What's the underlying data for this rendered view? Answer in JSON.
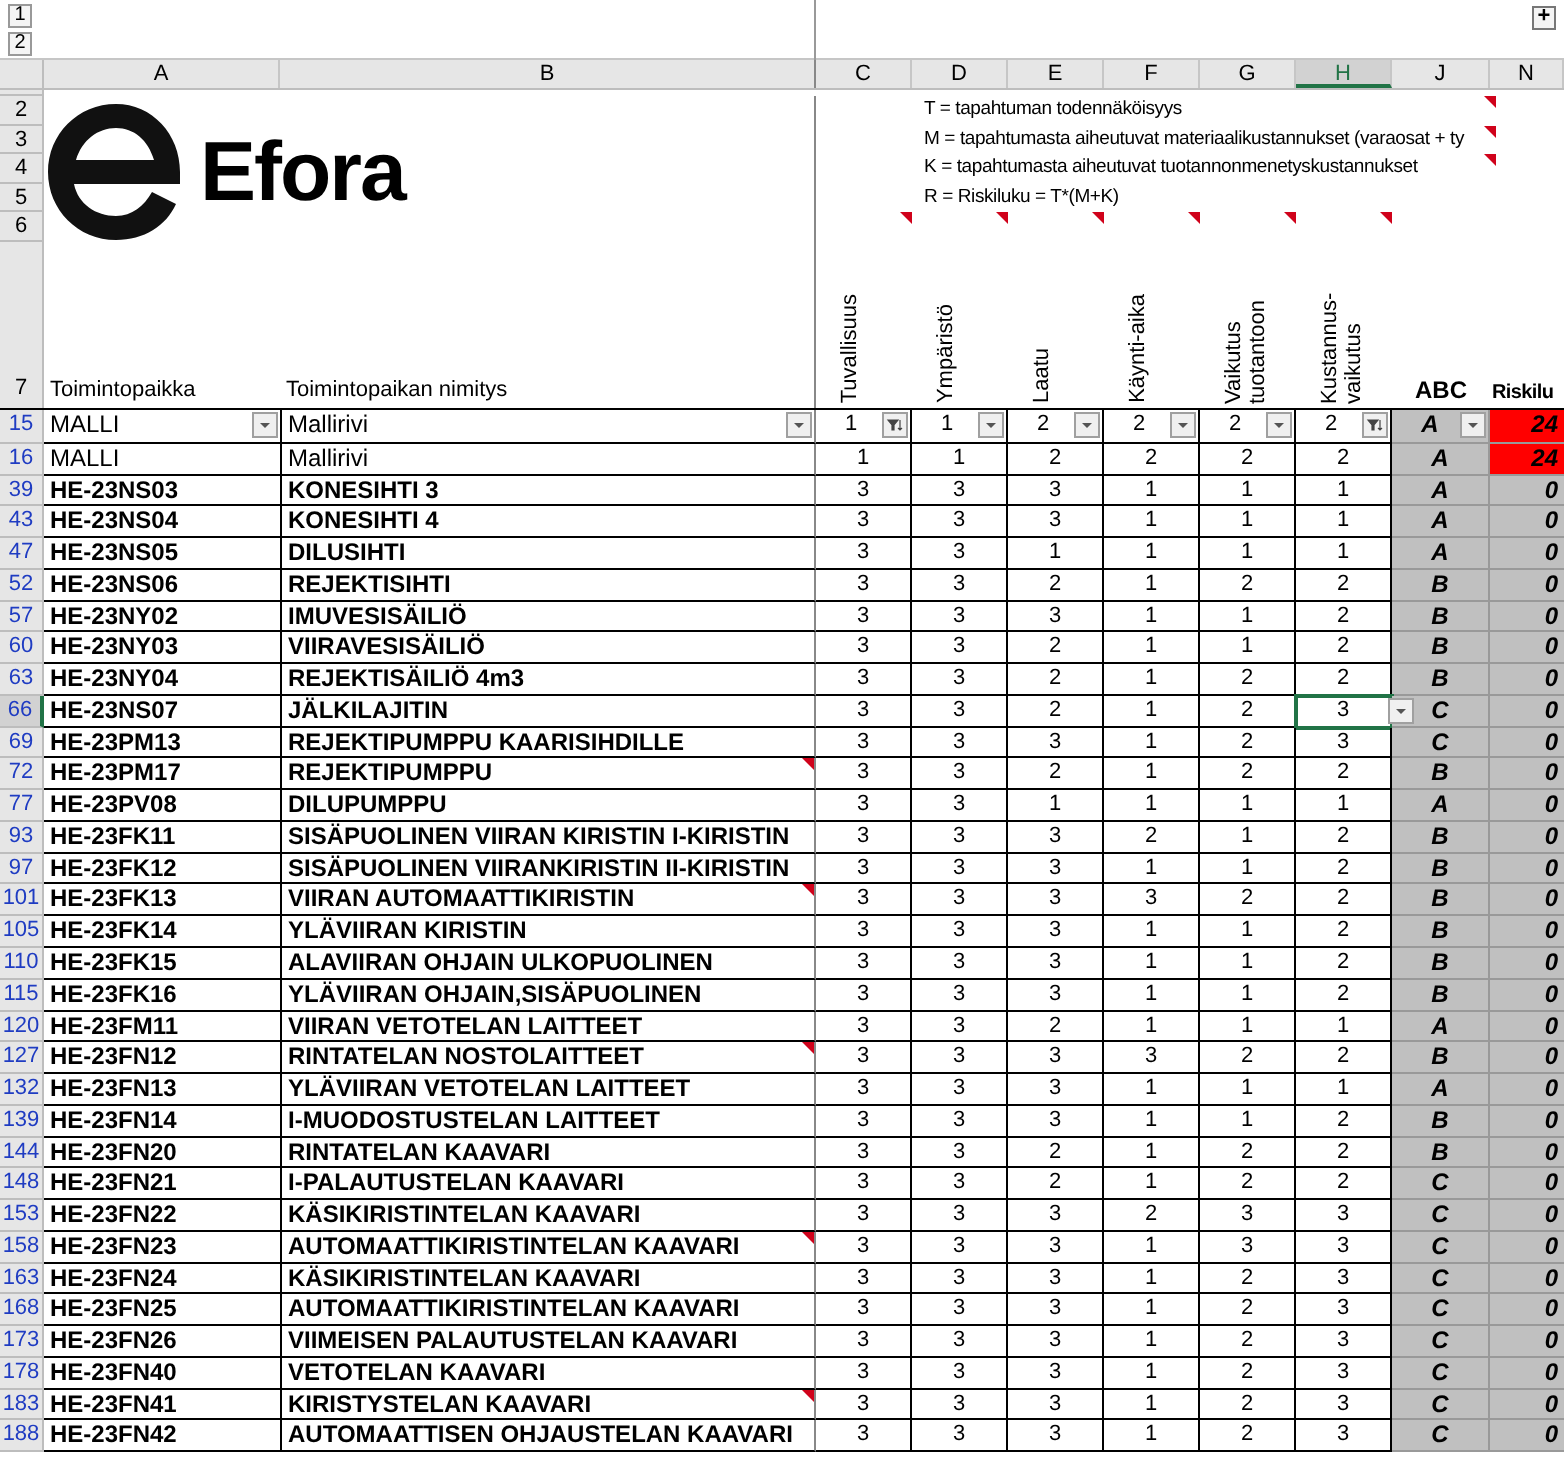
{
  "outline": {
    "levels": [
      "1",
      "2"
    ],
    "expand_symbol": "+"
  },
  "column_headers": [
    {
      "label": "A",
      "selected": false
    },
    {
      "label": "B",
      "selected": false
    },
    {
      "label": "C",
      "selected": false
    },
    {
      "label": "D",
      "selected": false
    },
    {
      "label": "E",
      "selected": false
    },
    {
      "label": "F",
      "selected": false
    },
    {
      "label": "G",
      "selected": false
    },
    {
      "label": "H",
      "selected": true
    },
    {
      "label": "J",
      "selected": false
    },
    {
      "label": "N",
      "selected": false
    }
  ],
  "header_row_numbers": [
    "2",
    "3",
    "4",
    "5",
    "6",
    "7"
  ],
  "logo": {
    "text": "Efora"
  },
  "legend": [
    {
      "text": "T =   tapahtuman todennäköisyys",
      "comment": true
    },
    {
      "text": "M =   tapahtumasta aiheutuvat materiaalikustannukset (varaosat + ty",
      "comment": true
    },
    {
      "text": "K =  tapahtumasta aiheutuvat  tuotannonmenetyskustannukset",
      "comment": true
    },
    {
      "text": "R = Riskiluku = T*(M+K)",
      "comment": false
    }
  ],
  "titles": {
    "location": "Toimintopaikka",
    "name": "Toimintopaikan nimitys",
    "class": "ABC",
    "risk": "Riskilu"
  },
  "criteria": [
    {
      "label": "Tuvallisuus",
      "comment": true
    },
    {
      "label": "Ympäristö",
      "comment": true
    },
    {
      "label": "Laatu",
      "comment": true
    },
    {
      "label": "Käynti-aika",
      "comment": true
    },
    {
      "label": "Vaikutus tuotantoon",
      "comment": true
    },
    {
      "label": "Kustannus-vaikutus",
      "comment": true
    }
  ],
  "rows": [
    {
      "number": "15",
      "kind": "filter",
      "code": "MALLI",
      "name": "Mallirivi",
      "values": [
        "1",
        "1",
        "2",
        "2",
        "2",
        "2"
      ],
      "filter_active": [
        true,
        false,
        false,
        false,
        false,
        true
      ],
      "class": "A",
      "risk": "24",
      "alert": true,
      "comment": false,
      "selected": false
    },
    {
      "number": "16",
      "kind": "template",
      "code": "MALLI",
      "name": "Mallirivi",
      "values": [
        "1",
        "1",
        "2",
        "2",
        "2",
        "2"
      ],
      "class": "A",
      "risk": "24",
      "alert": true,
      "comment": false,
      "selected": false
    },
    {
      "number": "39",
      "kind": "item",
      "code": "HE-23NS03",
      "name": "KONESIHTI 3",
      "values": [
        "3",
        "3",
        "3",
        "1",
        "1",
        "1"
      ],
      "class": "A",
      "risk": "0",
      "alert": false,
      "comment": false,
      "selected": false
    },
    {
      "number": "43",
      "kind": "item",
      "code": "HE-23NS04",
      "name": "KONESIHTI 4",
      "values": [
        "3",
        "3",
        "3",
        "1",
        "1",
        "1"
      ],
      "class": "A",
      "risk": "0",
      "alert": false,
      "comment": false,
      "selected": false
    },
    {
      "number": "47",
      "kind": "item",
      "code": "HE-23NS05",
      "name": "DILUSIHTI",
      "values": [
        "3",
        "3",
        "1",
        "1",
        "1",
        "1"
      ],
      "class": "A",
      "risk": "0",
      "alert": false,
      "comment": false,
      "selected": false
    },
    {
      "number": "52",
      "kind": "item",
      "code": "HE-23NS06",
      "name": "REJEKTISIHTI",
      "values": [
        "3",
        "3",
        "2",
        "1",
        "2",
        "2"
      ],
      "class": "B",
      "risk": "0",
      "alert": false,
      "comment": false,
      "selected": false
    },
    {
      "number": "57",
      "kind": "item",
      "code": "HE-23NY02",
      "name": "IMUVESISÄILIÖ",
      "values": [
        "3",
        "3",
        "3",
        "1",
        "1",
        "2"
      ],
      "class": "B",
      "risk": "0",
      "alert": false,
      "comment": false,
      "selected": false
    },
    {
      "number": "60",
      "kind": "item",
      "code": "HE-23NY03",
      "name": "VIIRAVESISÄILIÖ",
      "values": [
        "3",
        "3",
        "2",
        "1",
        "1",
        "2"
      ],
      "class": "B",
      "risk": "0",
      "alert": false,
      "comment": false,
      "selected": false
    },
    {
      "number": "63",
      "kind": "item",
      "code": "HE-23NY04",
      "name": "REJEKTISÄILIÖ 4m3",
      "values": [
        "3",
        "3",
        "2",
        "1",
        "2",
        "2"
      ],
      "class": "B",
      "risk": "0",
      "alert": false,
      "comment": false,
      "selected": false
    },
    {
      "number": "66",
      "kind": "item",
      "code": "HE-23NS07",
      "name": "JÄLKILAJITIN",
      "values": [
        "3",
        "3",
        "2",
        "1",
        "2",
        "3"
      ],
      "class": "C",
      "risk": "0",
      "alert": false,
      "comment": false,
      "selected": true
    },
    {
      "number": "69",
      "kind": "item",
      "code": "HE-23PM13",
      "name": "REJEKTIPUMPPU KAARISIHDILLE",
      "values": [
        "3",
        "3",
        "3",
        "1",
        "2",
        "3"
      ],
      "class": "C",
      "risk": "0",
      "alert": false,
      "comment": false,
      "selected": false
    },
    {
      "number": "72",
      "kind": "item",
      "code": "HE-23PM17",
      "name": "REJEKTIPUMPPU",
      "values": [
        "3",
        "3",
        "2",
        "1",
        "2",
        "2"
      ],
      "class": "B",
      "risk": "0",
      "alert": false,
      "comment": true,
      "selected": false
    },
    {
      "number": "77",
      "kind": "item",
      "code": "HE-23PV08",
      "name": "DILUPUMPPU",
      "values": [
        "3",
        "3",
        "1",
        "1",
        "1",
        "1"
      ],
      "class": "A",
      "risk": "0",
      "alert": false,
      "comment": false,
      "selected": false
    },
    {
      "number": "93",
      "kind": "item",
      "code": "HE-23FK11",
      "name": "SISÄPUOLINEN VIIRAN KIRISTIN I-KIRISTIN",
      "values": [
        "3",
        "3",
        "3",
        "2",
        "1",
        "2"
      ],
      "class": "B",
      "risk": "0",
      "alert": false,
      "comment": false,
      "selected": false
    },
    {
      "number": "97",
      "kind": "item",
      "code": "HE-23FK12",
      "name": "SISÄPUOLINEN VIIRANKIRISTIN II-KIRISTIN",
      "values": [
        "3",
        "3",
        "3",
        "1",
        "1",
        "2"
      ],
      "class": "B",
      "risk": "0",
      "alert": false,
      "comment": false,
      "selected": false
    },
    {
      "number": "101",
      "kind": "item",
      "code": "HE-23FK13",
      "name": "VIIRAN AUTOMAATTIKIRISTIN",
      "values": [
        "3",
        "3",
        "3",
        "3",
        "2",
        "2"
      ],
      "class": "B",
      "risk": "0",
      "alert": false,
      "comment": true,
      "selected": false
    },
    {
      "number": "105",
      "kind": "item",
      "code": "HE-23FK14",
      "name": "YLÄVIIRAN KIRISTIN",
      "values": [
        "3",
        "3",
        "3",
        "1",
        "1",
        "2"
      ],
      "class": "B",
      "risk": "0",
      "alert": false,
      "comment": false,
      "selected": false
    },
    {
      "number": "110",
      "kind": "item",
      "code": "HE-23FK15",
      "name": "ALAVIIRAN OHJAIN ULKOPUOLINEN",
      "values": [
        "3",
        "3",
        "3",
        "1",
        "1",
        "2"
      ],
      "class": "B",
      "risk": "0",
      "alert": false,
      "comment": false,
      "selected": false
    },
    {
      "number": "115",
      "kind": "item",
      "code": "HE-23FK16",
      "name": "YLÄVIIRAN OHJAIN,SISÄPUOLINEN",
      "values": [
        "3",
        "3",
        "3",
        "1",
        "1",
        "2"
      ],
      "class": "B",
      "risk": "0",
      "alert": false,
      "comment": false,
      "selected": false
    },
    {
      "number": "120",
      "kind": "item",
      "code": "HE-23FM11",
      "name": "VIIRAN VETOTELAN LAITTEET",
      "values": [
        "3",
        "3",
        "2",
        "1",
        "1",
        "1"
      ],
      "class": "A",
      "risk": "0",
      "alert": false,
      "comment": false,
      "selected": false
    },
    {
      "number": "127",
      "kind": "item",
      "code": "HE-23FN12",
      "name": "RINTATELAN NOSTOLAITTEET",
      "values": [
        "3",
        "3",
        "3",
        "3",
        "2",
        "2"
      ],
      "class": "B",
      "risk": "0",
      "alert": false,
      "comment": true,
      "selected": false
    },
    {
      "number": "132",
      "kind": "item",
      "code": "HE-23FN13",
      "name": "YLÄVIIRAN VETOTELAN LAITTEET",
      "values": [
        "3",
        "3",
        "3",
        "1",
        "1",
        "1"
      ],
      "class": "A",
      "risk": "0",
      "alert": false,
      "comment": false,
      "selected": false
    },
    {
      "number": "139",
      "kind": "item",
      "code": "HE-23FN14",
      "name": "I-MUODOSTUSTELAN LAITTEET",
      "values": [
        "3",
        "3",
        "3",
        "1",
        "1",
        "2"
      ],
      "class": "B",
      "risk": "0",
      "alert": false,
      "comment": false,
      "selected": false
    },
    {
      "number": "144",
      "kind": "item",
      "code": "HE-23FN20",
      "name": "RINTATELAN KAAVARI",
      "values": [
        "3",
        "3",
        "2",
        "1",
        "2",
        "2"
      ],
      "class": "B",
      "risk": "0",
      "alert": false,
      "comment": false,
      "selected": false
    },
    {
      "number": "148",
      "kind": "item",
      "code": "HE-23FN21",
      "name": "I-PALAUTUSTELAN KAAVARI",
      "values": [
        "3",
        "3",
        "2",
        "1",
        "2",
        "2"
      ],
      "class": "C",
      "risk": "0",
      "alert": false,
      "comment": false,
      "selected": false
    },
    {
      "number": "153",
      "kind": "item",
      "code": "HE-23FN22",
      "name": "KÄSIKIRISTINTELAN KAAVARI",
      "values": [
        "3",
        "3",
        "3",
        "2",
        "3",
        "3"
      ],
      "class": "C",
      "risk": "0",
      "alert": false,
      "comment": false,
      "selected": false
    },
    {
      "number": "158",
      "kind": "item",
      "code": "HE-23FN23",
      "name": "AUTOMAATTIKIRISTINTELAN KAAVARI",
      "values": [
        "3",
        "3",
        "3",
        "1",
        "3",
        "3"
      ],
      "class": "C",
      "risk": "0",
      "alert": false,
      "comment": true,
      "selected": false
    },
    {
      "number": "163",
      "kind": "item",
      "code": "HE-23FN24",
      "name": "KÄSIKIRISTINTELAN KAAVARI",
      "values": [
        "3",
        "3",
        "3",
        "1",
        "2",
        "3"
      ],
      "class": "C",
      "risk": "0",
      "alert": false,
      "comment": false,
      "selected": false
    },
    {
      "number": "168",
      "kind": "item",
      "code": "HE-23FN25",
      "name": "AUTOMAATTIKIRISTINTELAN KAAVARI",
      "values": [
        "3",
        "3",
        "3",
        "1",
        "2",
        "3"
      ],
      "class": "C",
      "risk": "0",
      "alert": false,
      "comment": false,
      "selected": false
    },
    {
      "number": "173",
      "kind": "item",
      "code": "HE-23FN26",
      "name": "VIIMEISEN PALAUTUSTELAN KAAVARI",
      "values": [
        "3",
        "3",
        "3",
        "1",
        "2",
        "3"
      ],
      "class": "C",
      "risk": "0",
      "alert": false,
      "comment": false,
      "selected": false
    },
    {
      "number": "178",
      "kind": "item",
      "code": "HE-23FN40",
      "name": "VETOTELAN KAAVARI",
      "values": [
        "3",
        "3",
        "3",
        "1",
        "2",
        "3"
      ],
      "class": "C",
      "risk": "0",
      "alert": false,
      "comment": false,
      "selected": false
    },
    {
      "number": "183",
      "kind": "item",
      "code": "HE-23FN41",
      "name": "KIRISTYSTELAN KAAVARI",
      "values": [
        "3",
        "3",
        "3",
        "1",
        "2",
        "3"
      ],
      "class": "C",
      "risk": "0",
      "alert": false,
      "comment": true,
      "selected": false
    },
    {
      "number": "188",
      "kind": "item",
      "code": "HE-23FN42",
      "name": "AUTOMAATTISEN OHJAUSTELAN KAAVARI",
      "values": [
        "3",
        "3",
        "3",
        "1",
        "2",
        "3"
      ],
      "class": "C",
      "risk": "0",
      "alert": false,
      "comment": false,
      "selected": false
    }
  ]
}
